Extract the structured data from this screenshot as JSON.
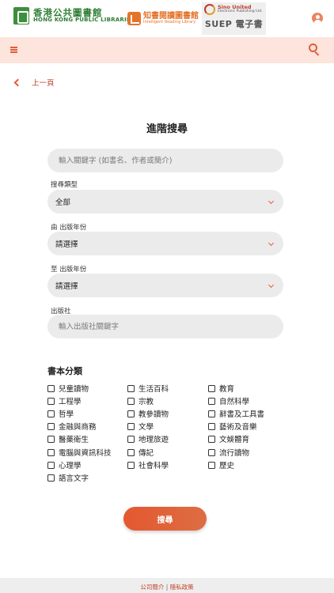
{
  "header": {
    "hkpl_logo_zh": "香港公共圖書館",
    "hkpl_logo_en": "HONG KONG PUBLIC LIBRARIES",
    "partner_logo_zh": "知書閱讀圖書館",
    "partner_logo_en": "Intelligent Reading Library",
    "suep_company": "Sino United",
    "suep_company_sub": "Electronic Publishing Ltd.",
    "suep_name": "SUEP 電子書"
  },
  "nav": {
    "back_label": "上一頁"
  },
  "form": {
    "title": "進階搜尋",
    "keyword_placeholder": "輸入關鍵字 (如書名、作者或簡介)",
    "search_type_label": "搜尋類型",
    "search_type_value": "全部",
    "year_from_label": "由 出版年份",
    "year_from_value": "請選擇",
    "year_to_label": "至 出版年份",
    "year_to_value": "請選擇",
    "publisher_label": "出版社",
    "publisher_placeholder": "輸入出版社關鍵字"
  },
  "categories": {
    "title": "書本分類",
    "items": [
      "兒童讀物",
      "生活百科",
      "教育",
      "工程學",
      "宗教",
      "自然科學",
      "哲學",
      "教參讀物",
      "辭書及工具書",
      "金融與商務",
      "文學",
      "藝術及音樂",
      "醫藥衛生",
      "地理旅遊",
      "文娛體育",
      "電腦與資訊科技",
      "傳記",
      "流行讀物",
      "心理學",
      "社會科學",
      "歷史",
      "語言文字"
    ]
  },
  "actions": {
    "search_label": "搜尋"
  },
  "footer": {
    "about_label": "公司簡介",
    "separator": "|",
    "privacy_label": "隱私政策"
  },
  "colors": {
    "accent": "#e35d38",
    "nav_bg": "#fde4dc",
    "field_bg": "#ebebeb"
  }
}
